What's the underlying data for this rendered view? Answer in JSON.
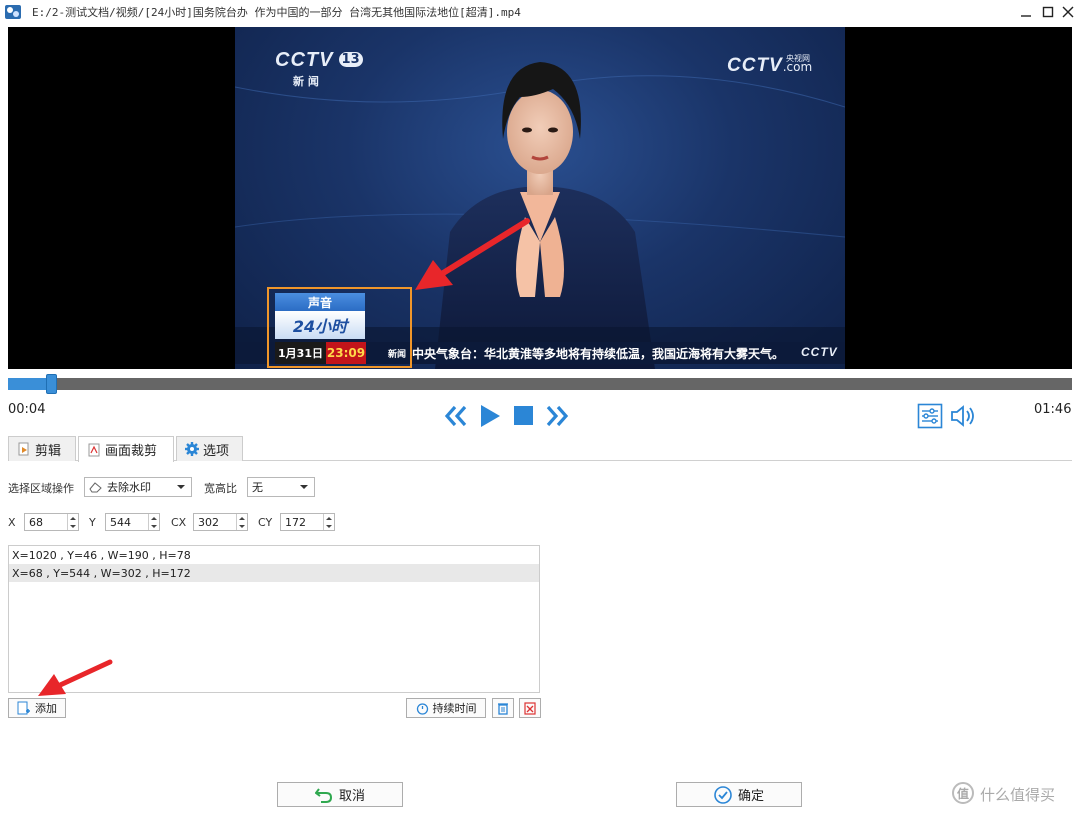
{
  "window": {
    "title": "E:/2-测试文档/视频/[24小时]国务院台办 作为中国的一部分 台湾无其他国际法地位[超清].mp4"
  },
  "video": {
    "channel_logo": "CCTV",
    "channel_number": "13",
    "channel_name": "新 闻",
    "site_logo": "CCTV",
    "site_logo_sub": "央视网",
    "site_logo_com": ".com",
    "badge_top": "声音",
    "badge_mid": "24小时",
    "badge_date": "1月31日",
    "badge_time": "23:09",
    "ticker_label": "新闻",
    "ticker_text": "中央气象台：华北黄淮等多地将有持续低温，我国近海将有大雾天气。",
    "ticker_logo": "CCTV"
  },
  "player": {
    "current_time": "00:04",
    "total_time": "01:46",
    "progress_fraction": 0.04
  },
  "tabs": [
    {
      "label": "剪辑",
      "icon": "clip-icon"
    },
    {
      "label": "画面裁剪",
      "icon": "crop-icon"
    },
    {
      "label": "选项",
      "icon": "gear-icon"
    }
  ],
  "form": {
    "region_op_label": "选择区域操作",
    "region_op_value": "去除水印",
    "aspect_label": "宽高比",
    "aspect_value": "无",
    "x_label": "X",
    "x_value": "68",
    "y_label": "Y",
    "y_value": "544",
    "cx_label": "CX",
    "cx_value": "302",
    "cy_label": "CY",
    "cy_value": "172"
  },
  "regions": [
    "X=1020 , Y=46 , W=190 , H=78",
    "X=68 , Y=544 , W=302 , H=172"
  ],
  "buttons": {
    "add": "添加",
    "duration": "持续时间",
    "cancel": "取消",
    "ok": "确定"
  },
  "watermark": {
    "text": "什么值得买",
    "logo": "值"
  },
  "colors": {
    "accent": "#3a8fd8",
    "highlight_box": "#f0962a",
    "annotation_arrow": "#e8262a"
  }
}
